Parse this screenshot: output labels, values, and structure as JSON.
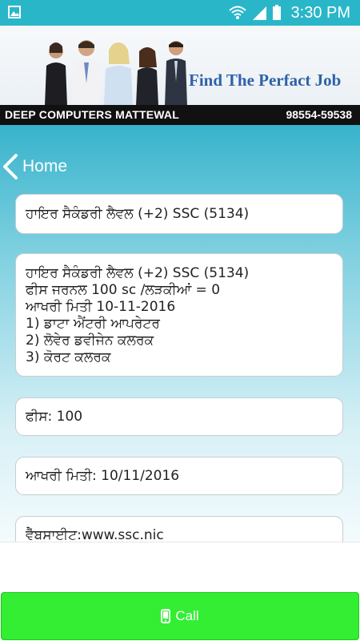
{
  "status_bar": {
    "time": "3:30 PM",
    "icons": [
      "image-icon",
      "wifi-icon",
      "signal-icon",
      "battery-icon"
    ]
  },
  "banner": {
    "tagline": "Find The Perfact Job",
    "company": "DEEP COMPUTERS MATTEWAL",
    "phone": "98554-59538"
  },
  "nav": {
    "back_label": "Home",
    "back_icon": "chevron-left-icon"
  },
  "job": {
    "title": "ਹਾਇਰ ਸੈਕੰਡਰੀ ਲੈਵਲ (+2) SSC (5134)",
    "details": [
      "ਹਾਇਰ ਸੈਕੰਡਰੀ ਲੈਵਲ (+2) SSC (5134)",
      "ਫੀਸ ਜਰਨਲ 100 sc /ਲੜਕੀਆਂ = 0",
      "ਆਖਰੀ ਮਿਤੀ 10-11-2016",
      "1) ਡਾਟਾ ਐਂਟਰੀ ਆਪਰੇਟਰ",
      "2) ਲੋਵੇਰ ਡਵੀਜੇਨ ਕਲਰਕ",
      "3) ਕੋਰਟ ਕਲਰਕ"
    ],
    "fee": "ਫੀਸ: 100",
    "last_date": "ਆਖਰੀ ਮਿਤੀ: 10/11/2016",
    "website": "ਵੈੱਬਸਾਈਟ:www.ssc.nic"
  },
  "call_button": {
    "label": "Call",
    "icon": "phone-icon"
  },
  "colors": {
    "status_bar": "#29b6c9",
    "gradient_top": "#38b3cc",
    "tagline": "#2f62a8",
    "call_button": "#33ee33"
  }
}
